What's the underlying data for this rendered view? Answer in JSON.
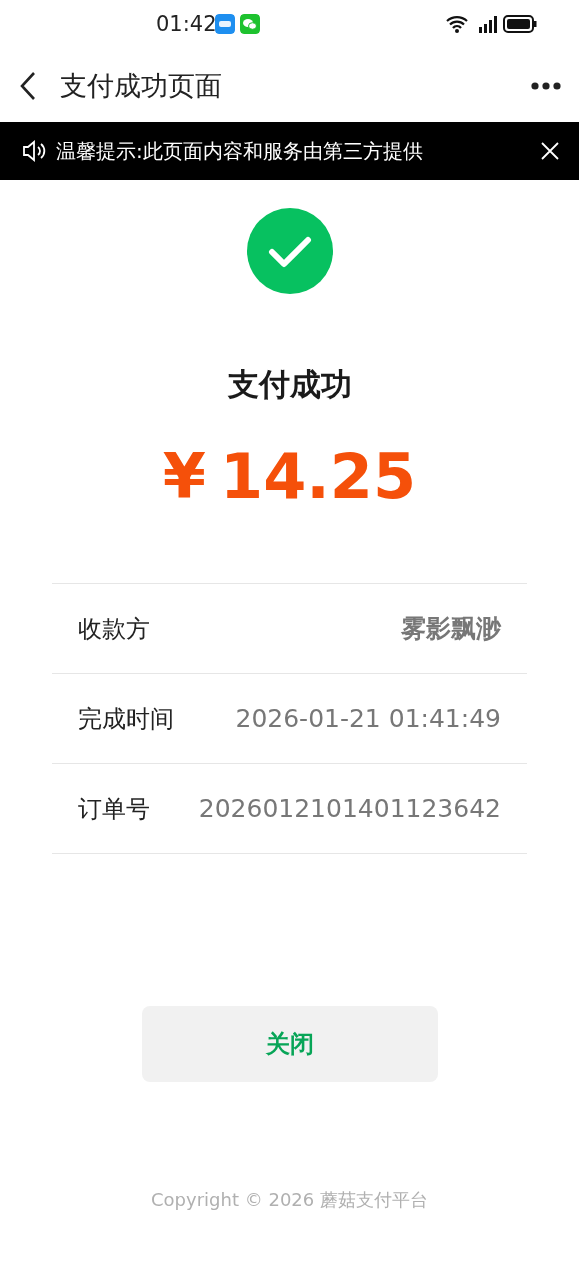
{
  "status_bar": {
    "time": "01:42"
  },
  "nav_bar": {
    "title": "支付成功页面"
  },
  "notice": {
    "text": "温馨提示:此页面内容和服务由第三方提供"
  },
  "result": {
    "title": "支付成功",
    "currency": "¥",
    "amount": "14.25"
  },
  "details": [
    {
      "label": "收款方",
      "value": "雾影飘渺",
      "kind": "bold"
    },
    {
      "label": "完成时间",
      "value": "2026-01-21 01:41:49",
      "kind": "plain"
    },
    {
      "label": "订单号",
      "value": "2026012101401123642",
      "kind": "plain"
    }
  ],
  "close_button": {
    "label": "关闭"
  },
  "footer": {
    "text": "Copyright © 2026 蘑菇支付平台"
  }
}
